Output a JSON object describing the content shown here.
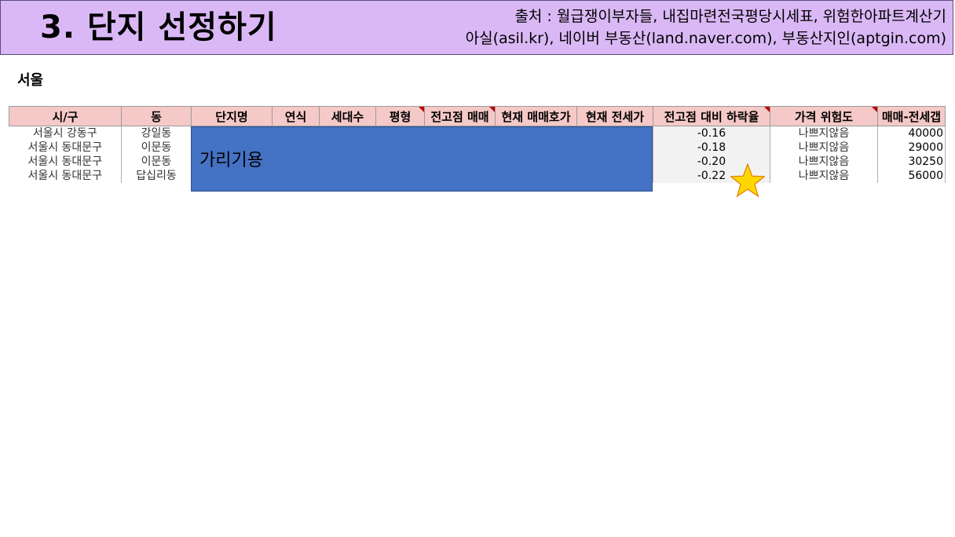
{
  "header": {
    "title": "3. 단지 선정하기",
    "source_line1": "출처 : 월급쟁이부자들, 내집마련전국평당시세표, 위험한아파트계산기",
    "source_line2": "아실(asil.kr), 네이버 부동산(land.naver.com), 부동산지인(aptgin.com)"
  },
  "region": "서울",
  "table": {
    "columns": [
      "시/구",
      "동",
      "단지명",
      "연식",
      "세대수",
      "평형",
      "전고점 매매",
      "현재 매매호가",
      "현재 전세가",
      "전고점 대비 하락율",
      "가격 위험도",
      "매매-전세갭"
    ],
    "rows": [
      {
        "city": "서울시 강동구",
        "dong": "강일동",
        "rate": "-0.16",
        "risk": "나쁘지않음",
        "gap": "40000"
      },
      {
        "city": "서울시 동대문구",
        "dong": "이문동",
        "rate": "-0.18",
        "risk": "나쁘지않음",
        "gap": "29000"
      },
      {
        "city": "서울시 동대문구",
        "dong": "이문동",
        "rate": "-0.20",
        "risk": "나쁘지않음",
        "gap": "30250"
      },
      {
        "city": "서울시 동대문구",
        "dong": "답십리동",
        "rate": "-0.22",
        "risk": "나쁘지않음",
        "gap": "56000"
      }
    ]
  },
  "cover": {
    "label": "가리기용",
    "color": "#4472c4"
  },
  "star": {
    "color": "#ffd700"
  }
}
